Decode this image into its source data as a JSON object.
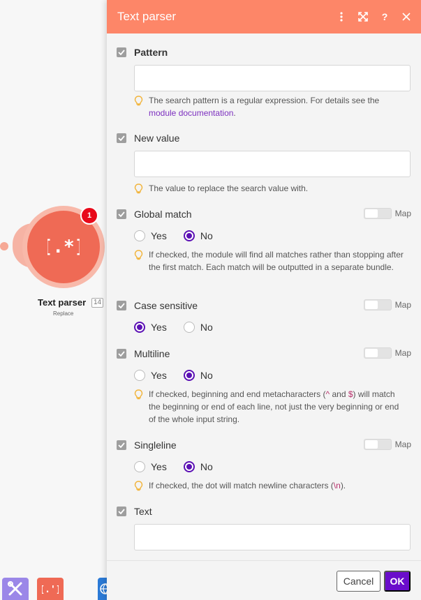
{
  "module": {
    "name": "Text parser",
    "id_badge": "14",
    "subtitle": "Replace",
    "notification_count": "1",
    "glyph": "[.*]",
    "color": "#ef6a55"
  },
  "panel": {
    "title": "Text parser",
    "header_color": "#fd8668",
    "icons": [
      "more-vertical-icon",
      "expand-icon",
      "help-icon",
      "close-icon"
    ]
  },
  "fields": {
    "pattern": {
      "label": "Pattern",
      "value": "",
      "hint": "The search pattern is a regular expression. For details see the",
      "hint_link": "module documentation",
      "hint_end": "."
    },
    "new_value": {
      "label": "New value",
      "value": "",
      "hint": "The value to replace the search value with."
    },
    "global_match": {
      "label": "Global match",
      "map_label": "Map",
      "options": [
        "Yes",
        "No"
      ],
      "selected": "No",
      "hint": "If checked, the module will find all matches rather than stopping after the first match. Each match will be outputted in a separate bundle."
    },
    "case_sensitive": {
      "label": "Case sensitive",
      "map_label": "Map",
      "options": [
        "Yes",
        "No"
      ],
      "selected": "Yes"
    },
    "multiline": {
      "label": "Multiline",
      "map_label": "Map",
      "options": [
        "Yes",
        "No"
      ],
      "selected": "No",
      "hint_a": "If checked, beginning and end metacharacters (",
      "hint_code1": "^",
      "hint_b": " and ",
      "hint_code2": "$",
      "hint_c": ") will match the beginning or end of each line, not just the very beginning or end of the whole input string."
    },
    "singleline": {
      "label": "Singleline",
      "map_label": "Map",
      "options": [
        "Yes",
        "No"
      ],
      "selected": "No",
      "hint_a": "If checked, the dot will match newline characters (",
      "hint_code": "\\n",
      "hint_b": ")."
    },
    "text": {
      "label": "Text",
      "value": ""
    }
  },
  "footer": {
    "cancel_label": "Cancel",
    "ok_label": "OK",
    "ok_color": "#6a0dcb"
  }
}
